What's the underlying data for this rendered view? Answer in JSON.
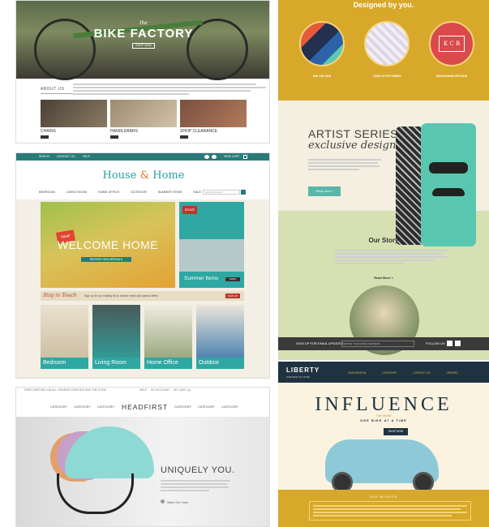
{
  "bike": {
    "logo_top": "the",
    "logo": "BIKE FACTORY",
    "shop_button": "SHOP NOW",
    "about_label": "ABOUT US",
    "categories": [
      {
        "label": "CHAINS"
      },
      {
        "label": "HANDLEBARS"
      },
      {
        "label": "SHOP CLEARANCE"
      }
    ]
  },
  "designed": {
    "title": "Designed by you.",
    "items": [
      {
        "label": "MIX COLORS"
      },
      {
        "label": "TONS OF PATTERNS"
      },
      {
        "label": "MONOGRAM OPTIONS"
      }
    ],
    "monogram": "K C B"
  },
  "house": {
    "topbar": {
      "sign_in": "SIGN IN",
      "contact": "CONTACT US",
      "help": "HELP",
      "cart": "VIEW CART"
    },
    "brand_left": "House",
    "brand_amp": "&",
    "brand_right": "Home",
    "nav": [
      "BEDROOM",
      "LIVING ROOM",
      "HOME OFFICE",
      "OUTDOOR",
      "SUMMER ITEMS",
      "SALE"
    ],
    "search_placeholder": "search products",
    "welcome_badge": "New!",
    "welcome_title": "WELCOME HOME",
    "welcome_button": "BROWSE NEW ARRIVALS",
    "summer_badge": "SALE!",
    "summer_label": "Summer Items",
    "summer_button": "SHOP",
    "stay_title": "Stay in Touch",
    "stay_text": "Sign up for our mailing list to receive news and special offers",
    "signup_button": "SIGN UP",
    "rooms": [
      {
        "label": "Bedroom"
      },
      {
        "label": "Living Room"
      },
      {
        "label": "Home Office"
      },
      {
        "label": "Outdoor"
      }
    ]
  },
  "artist": {
    "heading1": "ARTIST SERIES",
    "heading2": "exclusive designs",
    "shop_button": "Shop now »",
    "story_title": "Our Story",
    "read_more": "Read More »",
    "footer_signup": "SIGN UP FOR EMAIL UPDATES",
    "footer_email_placeholder": "ENTER YOUR EMAIL ADDRESS",
    "footer_follow": "FOLLOW US"
  },
  "head": {
    "topline": "FREE SHIPPING ON ALL ORDERS OVER $75 USE THE CODE",
    "help": "HELP",
    "account": "MY ACCOUNT",
    "cart": "MY CART (2)",
    "nav_left": [
      "CATEGORY",
      "CATEGORY",
      "CATEGORY"
    ],
    "brand": "HEADFIRST",
    "nav_right": [
      "CATEGORY",
      "CATEGORY",
      "CATEGORY"
    ],
    "headline": "UNIQUELY YOU.",
    "play_label": "Watch Our Video"
  },
  "liberty": {
    "logo": "LIBERTY",
    "logo_sub": "ONE BIKE AT A TIME",
    "links": [
      "OUR MISSION",
      "CATEGORY",
      "CONTACT US",
      "ORDERS"
    ],
    "title": "INFLUENCE",
    "subtitle": "The World",
    "tagline": "ONE BIKE AT A TIME",
    "shop_button": "SHOP NOW",
    "mission_label": "OUR MISSION"
  }
}
